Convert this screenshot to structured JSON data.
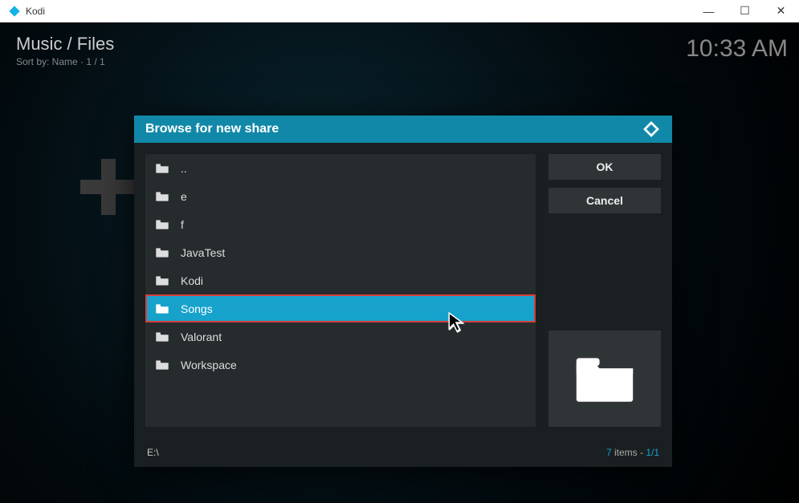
{
  "window": {
    "title": "Kodi"
  },
  "header": {
    "title": "Music / Files",
    "sort": "Sort by: Name   ·   1 / 1",
    "time": "10:33 AM"
  },
  "dialog": {
    "title": "Browse for new share",
    "items": [
      {
        "label": "..",
        "selected": false
      },
      {
        "label": "e",
        "selected": false
      },
      {
        "label": "f",
        "selected": false
      },
      {
        "label": "JavaTest",
        "selected": false
      },
      {
        "label": "Kodi",
        "selected": false
      },
      {
        "label": "Songs",
        "selected": true
      },
      {
        "label": "Valorant",
        "selected": false
      },
      {
        "label": "Workspace",
        "selected": false
      }
    ],
    "buttons": {
      "ok": "OK",
      "cancel": "Cancel"
    },
    "footer": {
      "path": "E:\\",
      "count": "7",
      "items_label": " items - ",
      "page": "1/1"
    }
  }
}
